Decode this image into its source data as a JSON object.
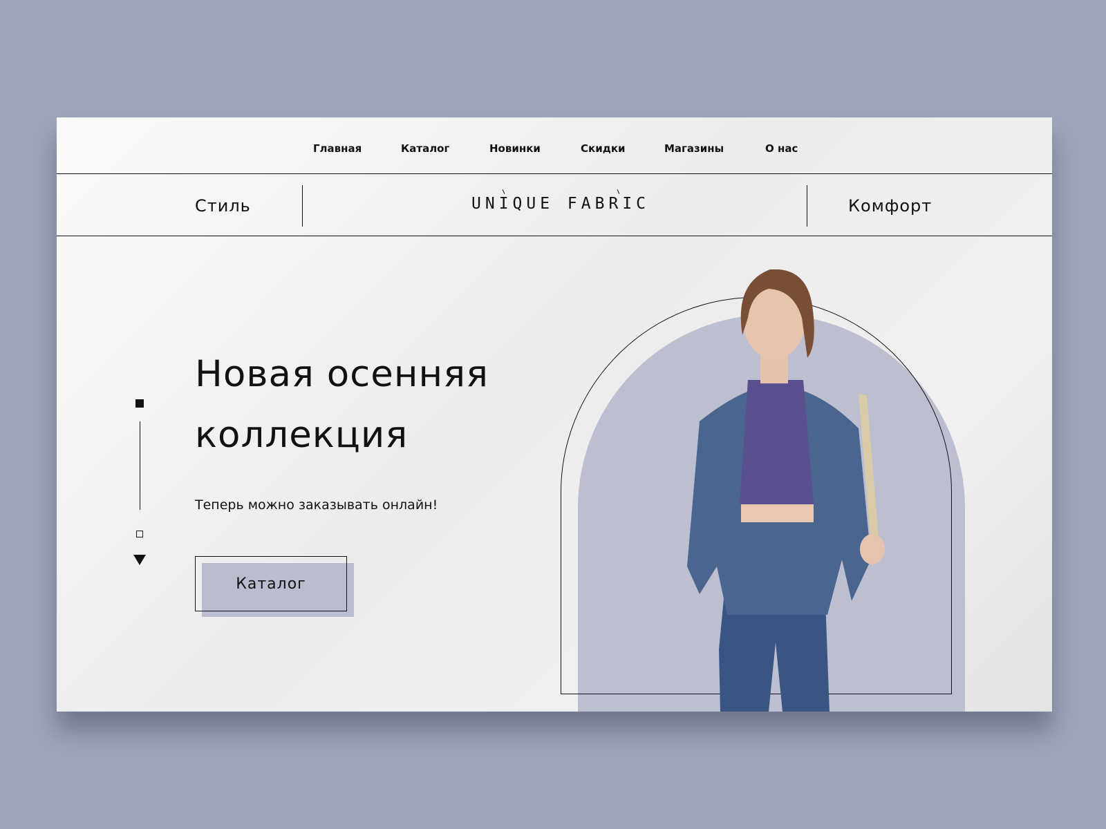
{
  "nav": {
    "items": [
      {
        "label": "Главная"
      },
      {
        "label": "Каталог"
      },
      {
        "label": "Новинки"
      },
      {
        "label": "Скидки"
      },
      {
        "label": "Магазины"
      },
      {
        "label": "О нас"
      }
    ]
  },
  "subheader": {
    "left_word": "Стиль",
    "brand": "UNIQUE FABRIC",
    "right_word": "Комфорт"
  },
  "hero": {
    "headline": "Новая осенняя коллекция",
    "subtitle": "Теперь можно заказывать онлайн!",
    "button_label": "Каталог",
    "slider": {
      "current": 1,
      "total": 2
    }
  },
  "colors": {
    "background": "#9fa5bb",
    "accent": "#babdcd",
    "text": "#111111",
    "denim": "#35507c",
    "sweater": "#5a4f8f"
  },
  "icons": {
    "slider_next": "triangle-down-icon"
  }
}
